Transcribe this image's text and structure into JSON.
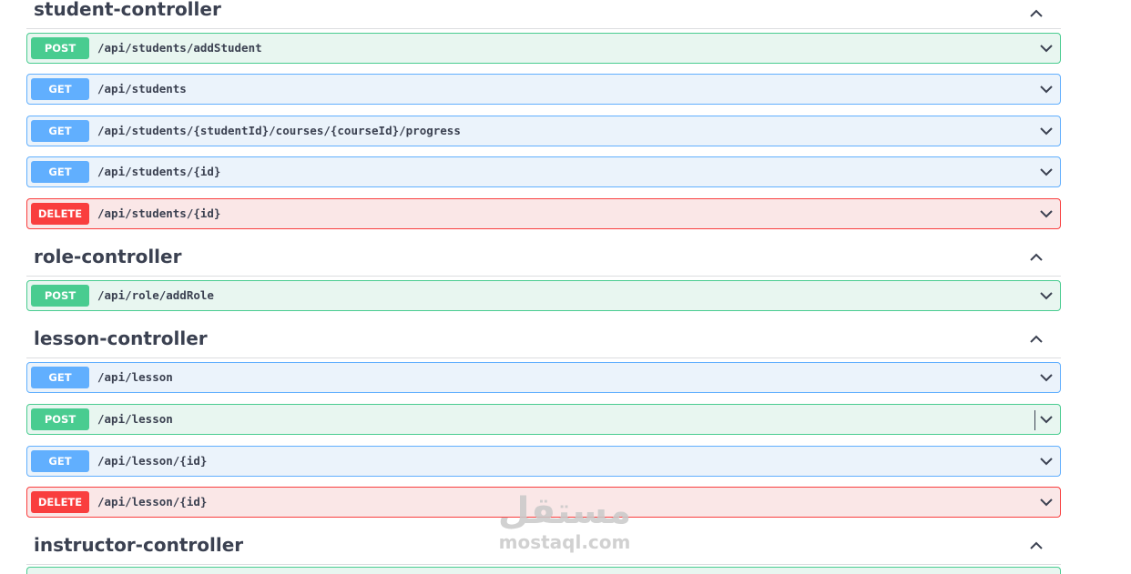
{
  "sections": [
    {
      "title": "student-controller",
      "operations": [
        {
          "method": "POST",
          "path": "/api/students/addStudent"
        },
        {
          "method": "GET",
          "path": "/api/students"
        },
        {
          "method": "GET",
          "path": "/api/students/{studentId}/courses/{courseId}/progress"
        },
        {
          "method": "GET",
          "path": "/api/students/{id}"
        },
        {
          "method": "DELETE",
          "path": "/api/students/{id}"
        }
      ]
    },
    {
      "title": "role-controller",
      "operations": [
        {
          "method": "POST",
          "path": "/api/role/addRole"
        }
      ]
    },
    {
      "title": "lesson-controller",
      "operations": [
        {
          "method": "GET",
          "path": "/api/lesson"
        },
        {
          "method": "POST",
          "path": "/api/lesson"
        },
        {
          "method": "GET",
          "path": "/api/lesson/{id}"
        },
        {
          "method": "DELETE",
          "path": "/api/lesson/{id}"
        }
      ]
    },
    {
      "title": "instructor-controller",
      "operations": []
    }
  ],
  "watermark": {
    "arabic": "مستقل",
    "latin": "mostaql.com"
  },
  "colors": {
    "post": "#49cc90",
    "get": "#61affe",
    "delete": "#f93e3e",
    "text": "#3b4151"
  },
  "icons": {
    "section_toggle": "chevron-up-icon",
    "operation_toggle": "chevron-down-icon"
  }
}
